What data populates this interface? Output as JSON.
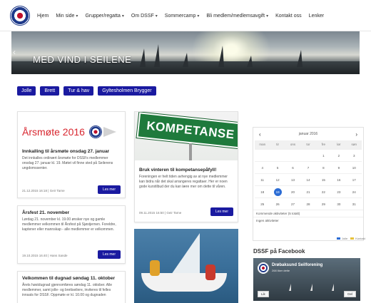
{
  "nav": {
    "items": [
      {
        "label": "Hjem",
        "dropdown": false
      },
      {
        "label": "Min side",
        "dropdown": true
      },
      {
        "label": "Grupper/regatta",
        "dropdown": true
      },
      {
        "label": "Om DSSF",
        "dropdown": true
      },
      {
        "label": "Sommercamp",
        "dropdown": true
      },
      {
        "label": "Bli medlem/medlemsavgift",
        "dropdown": true
      },
      {
        "label": "Kontakt oss",
        "dropdown": false
      },
      {
        "label": "Lenker",
        "dropdown": false
      }
    ]
  },
  "hero": {
    "title": "MED VIND I SEILENE"
  },
  "quick_buttons": [
    "Jolle",
    "Brett",
    "Tur & hav",
    "Gyltesholmen Brygger"
  ],
  "colors": {
    "accent": "#1a1aa0",
    "brand_red": "#d8262f",
    "today": "#2b6cd4",
    "sign_green": "#1f7a3c"
  },
  "cards": {
    "aarsmote": {
      "banner_title": "Årsmøte 2016",
      "title": "Innkalling til årsmøte onsdag 27. januar",
      "body": "Det innkalles ordinært årsmøte for DSSFs medlemmer onsdag 27. januar kl. 19. Møtet vil finne sted på Seilerens ungdomssenter.",
      "meta": "21.12.2015 16:18 | Geir Tarne",
      "button": "Les mer"
    },
    "kompetanse": {
      "sign": "KOMPETANSE",
      "title": "Bruk vinteren til kompetansepåfyll!",
      "body": "Foreningen er helt tiden avhengig av at nye medlemmer kan bidra når det skal arrangeres regattaer. Her er noen gode kurstilbud der du kan lære mer om dette til våren.",
      "meta": "09.11.2015 16:50 | Geir Tarne",
      "button": "Les mer"
    },
    "aarsfest": {
      "title": "Årsfest 21. november",
      "body": "Lørdag 21. november kl. 19.00 ønsker nye og gamle medlemmer velkommen til Årsfest på Sjøstjernen. Foreldre, kaptener eller mannskap - alle medlemmer er velkommen.",
      "meta": "19.10.2015 16:40 | Hans Sande",
      "button": "Les mer"
    },
    "dugnad": {
      "title": "Velkommen til dugnad søndag 11. oktober",
      "body": "Årets høstdugnad gjennomføres søndag 11. oktober. Alle medlemmer, samt jolle- og brettseilere, inviteres til felles innsats for DSSF. Oppmøte er kl. 10.00 og dugnaden"
    }
  },
  "calendar": {
    "month_label": "januar 2016",
    "weekdays": [
      "man",
      "tir",
      "ons",
      "tor",
      "fre",
      "lør",
      "søn"
    ],
    "days": [
      "",
      "",
      "",
      "",
      "1",
      "2",
      "3",
      "4",
      "5",
      "6",
      "7",
      "8",
      "9",
      "10",
      "11",
      "12",
      "13",
      "14",
      "15",
      "16",
      "17",
      "18",
      "19",
      "20",
      "21",
      "22",
      "23",
      "24",
      "25",
      "26",
      "27",
      "28",
      "29",
      "30",
      "31"
    ],
    "today": "19",
    "notes": [
      "Kommende aktiviteter (5 totalt)",
      "Ingen aktiviteter"
    ],
    "legend": [
      "Jolle",
      "Kontakt"
    ]
  },
  "facebook": {
    "title": "DSSF på Facebook",
    "page_name": "Drøbaksund Seilforening",
    "likes": "268 liker dette",
    "like_label": "Lik",
    "share_label": "Del"
  }
}
